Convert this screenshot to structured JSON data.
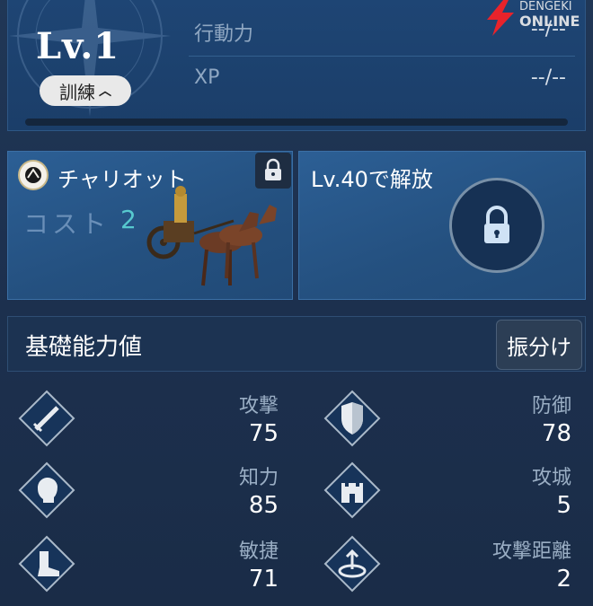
{
  "header": {
    "level_text": "Lv.1",
    "training_badge": "訓練",
    "action_power_label": "行動力",
    "action_power_value": "--/--",
    "xp_label": "XP",
    "xp_value": "--/--"
  },
  "watermark": {
    "line1": "DENGEKI",
    "line2": "ONLINE"
  },
  "skills": {
    "slot1": {
      "name": "チャリオット",
      "cost_label": "コスト",
      "cost_value": "2",
      "locked": true
    },
    "slot2": {
      "unlock_text": "Lv.40で解放",
      "locked": true
    }
  },
  "base_stats": {
    "title": "基礎能力値",
    "assign_button": "振分け",
    "items": [
      {
        "label": "攻撃",
        "value": "75",
        "icon": "sword-icon"
      },
      {
        "label": "防御",
        "value": "78",
        "icon": "shield-icon"
      },
      {
        "label": "知力",
        "value": "85",
        "icon": "head-icon"
      },
      {
        "label": "攻城",
        "value": "5",
        "icon": "castle-icon"
      },
      {
        "label": "敏捷",
        "value": "71",
        "icon": "boot-icon"
      },
      {
        "label": "攻撃距離",
        "value": "2",
        "icon": "range-icon"
      }
    ]
  },
  "colors": {
    "panel_blue": "#1e4574",
    "card_blue": "#2c5f95",
    "cost_accent": "#57c9cf",
    "icon_fill": "#17345a"
  }
}
